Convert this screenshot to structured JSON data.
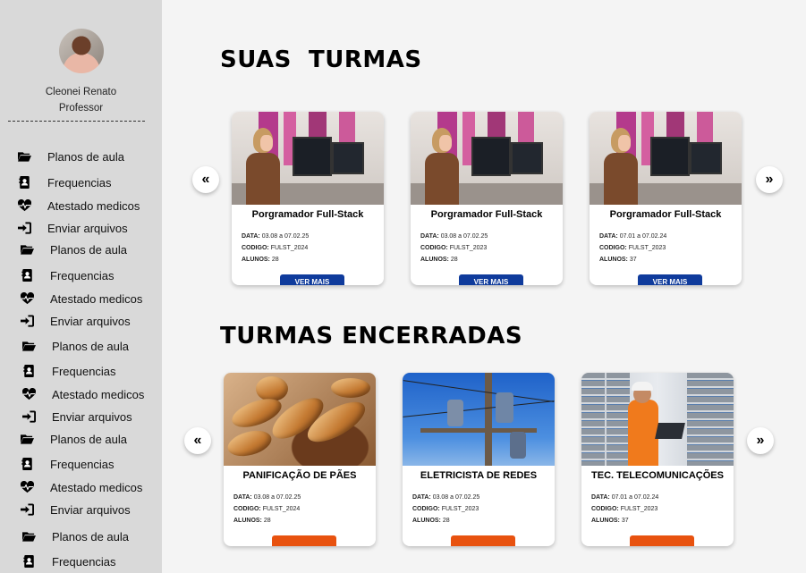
{
  "user": {
    "name": "Cleonei Renato",
    "role": "Professor"
  },
  "sidebar": {
    "items": [
      {
        "label": "Planos de aula",
        "icon": "folder-open-icon"
      },
      {
        "label": "Frequencias",
        "icon": "contact-book-icon"
      },
      {
        "label": "Atestado medicos",
        "icon": "heartbeat-icon"
      },
      {
        "label": "Enviar arquivos",
        "icon": "sign-in-arrow-icon"
      },
      {
        "label": "Planos de aula",
        "icon": "folder-open-icon"
      },
      {
        "label": "Frequencias",
        "icon": "contact-book-icon"
      },
      {
        "label": "Atestado medicos",
        "icon": "heartbeat-icon"
      },
      {
        "label": "Enviar arquivos",
        "icon": "sign-in-arrow-icon"
      },
      {
        "label": "Planos de aula",
        "icon": "folder-open-icon"
      },
      {
        "label": "Frequencias",
        "icon": "contact-book-icon"
      },
      {
        "label": "Atestado medicos",
        "icon": "heartbeat-icon"
      },
      {
        "label": "Enviar arquivos",
        "icon": "sign-in-arrow-icon"
      },
      {
        "label": "Planos de aula",
        "icon": "folder-open-icon"
      },
      {
        "label": "Frequencias",
        "icon": "contact-book-icon"
      },
      {
        "label": "Atestado medicos",
        "icon": "heartbeat-icon"
      },
      {
        "label": "Enviar arquivos",
        "icon": "sign-in-arrow-icon"
      },
      {
        "label": "Planos de aula",
        "icon": "folder-open-icon"
      },
      {
        "label": "Frequencias",
        "icon": "contact-book-icon"
      }
    ]
  },
  "active_section": {
    "title": "SUAS  TURMAS",
    "prev_label": "«",
    "next_label": "»",
    "cards": [
      {
        "title": "Porgramador Full-Stack",
        "data_label": "DATA:",
        "data_value": "03.08 a 07.02.25",
        "codigo_label": "CODIGO:",
        "codigo_value": "FULST_2024",
        "alunos_label": "ALUNOS:",
        "alunos_value": "28",
        "button": "VER MAIS"
      },
      {
        "title": "Porgramador Full-Stack",
        "data_label": "DATA:",
        "data_value": "03.08 a 07.02.25",
        "codigo_label": "CODIGO:",
        "codigo_value": "FULST_2023",
        "alunos_label": "ALUNOS:",
        "alunos_value": "28",
        "button": "VER MAIS"
      },
      {
        "title": "Porgramador Full-Stack",
        "data_label": "DATA:",
        "data_value": "07.01 a 07.02.24",
        "codigo_label": "CODIGO:",
        "codigo_value": "FULST_2023",
        "alunos_label": "ALUNOS:",
        "alunos_value": "37",
        "button": "VER MAIS"
      }
    ]
  },
  "closed_section": {
    "title": "TURMAS ENCERRADAS",
    "prev_label": "«",
    "next_label": "»",
    "cards": [
      {
        "title": "PANIFICAÇÃO DE PÃES",
        "data_label": "DATA:",
        "data_value": "03.08 a 07.02.25",
        "codigo_label": "CODIGO:",
        "codigo_value": "FULST_2024",
        "alunos_label": "ALUNOS:",
        "alunos_value": "28",
        "button": ""
      },
      {
        "title": "ELETRICISTA DE REDES",
        "data_label": "DATA:",
        "data_value": "03.08 a 07.02.25",
        "codigo_label": "CODIGO:",
        "codigo_value": "FULST_2023",
        "alunos_label": "ALUNOS:",
        "alunos_value": "28",
        "button": ""
      },
      {
        "title": "TEC. TELECOMUNICAÇÕES",
        "data_label": "DATA:",
        "data_value": "07.01 a 07.02.24",
        "codigo_label": "CODIGO:",
        "codigo_value": "FULST_2023",
        "alunos_label": "ALUNOS:",
        "alunos_value": "37",
        "button": ""
      }
    ]
  },
  "colors": {
    "sidebar_bg": "#d9d9d9",
    "page_bg": "#f4f4f4",
    "button_blue": "#0f3b9c",
    "button_orange": "#e8520f"
  }
}
